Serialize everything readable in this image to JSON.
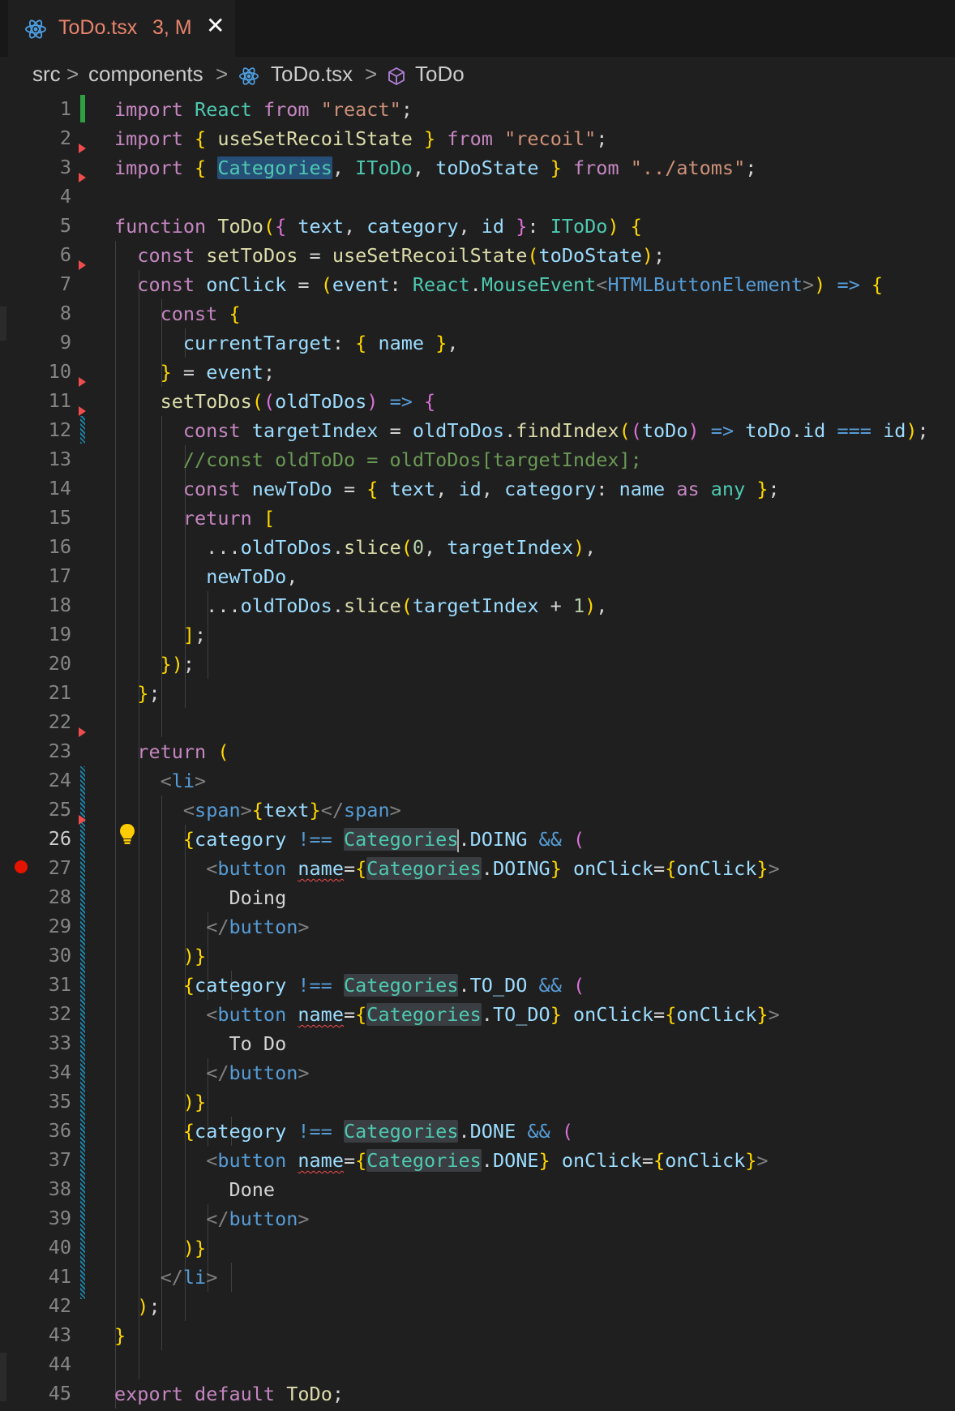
{
  "tab": {
    "filename": "ToDo.tsx",
    "badge": "3, M",
    "close": "✕",
    "icon": "react-icon"
  },
  "breadcrumb": {
    "src": "src",
    "components": "components",
    "file": "ToDo.tsx",
    "symbol": "ToDo",
    "separator": ">"
  },
  "editor": {
    "active_line": 26,
    "breakpoint_line": 27,
    "lightbulb_line": 26,
    "line_numbers": [
      "1",
      "2",
      "3",
      "4",
      "5",
      "6",
      "7",
      "8",
      "9",
      "10",
      "11",
      "12",
      "13",
      "14",
      "15",
      "16",
      "17",
      "18",
      "19",
      "20",
      "21",
      "22",
      "23",
      "24",
      "25",
      "26",
      "27",
      "28",
      "29",
      "30",
      "31",
      "32",
      "33",
      "34",
      "35",
      "36",
      "37",
      "38",
      "39",
      "40",
      "41",
      "42",
      "43",
      "44",
      "45"
    ],
    "code_lines": [
      "import React from \"react\";",
      "import { useSetRecoilState } from \"recoil\";",
      "import { Categories, IToDo, toDoState } from \"../atoms\";",
      "",
      "function ToDo({ text, category, id }: IToDo) {",
      "  const setToDos = useSetRecoilState(toDoState);",
      "  const onClick = (event: React.MouseEvent<HTMLButtonElement>) => {",
      "    const {",
      "      currentTarget: { name },",
      "    } = event;",
      "    setToDos((oldToDos) => {",
      "      const targetIndex = oldToDos.findIndex((toDo) => toDo.id === id);",
      "      //const oldToDo = oldToDos[targetIndex];",
      "      const newToDo = { text, id, category: name as any };",
      "      return [",
      "        ...oldToDos.slice(0, targetIndex),",
      "        newToDo,",
      "        ...oldToDos.slice(targetIndex + 1),",
      "      ];",
      "    });",
      "  };",
      "",
      "  return (",
      "    <li>",
      "      <span>{text}</span>",
      "      {category !== Categories.DOING && (",
      "        <button name={Categories.DOING} onClick={onClick}>",
      "          Doing",
      "        </button>",
      "      )}",
      "      {category !== Categories.TO_DO && (",
      "        <button name={Categories.TO_DO} onClick={onClick}>",
      "          To Do",
      "        </button>",
      "      )}",
      "      {category !== Categories.DONE && (",
      "        <button name={Categories.DONE} onClick={onClick}>",
      "          Done",
      "        </button>",
      "      )}",
      "    </li>",
      "  );",
      "}",
      "",
      "export default ToDo;"
    ]
  }
}
